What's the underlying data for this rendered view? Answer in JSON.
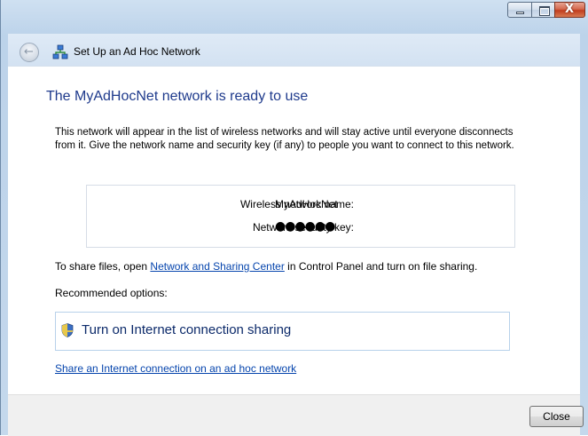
{
  "window": {
    "title": "Set Up an Ad Hoc Network",
    "caption_buttons": {
      "minimize_icon": "minimize-icon",
      "maximize_icon": "maximize-icon",
      "close_glyph": "X"
    }
  },
  "main": {
    "heading": "The MyAdHocNet network is ready to use",
    "description": "This network will appear in the list of wireless networks and will stay active until everyone disconnects from it. Give the network name and security key (if any) to people you want to connect to this network.",
    "network_info": {
      "name_label": "Wireless network name:",
      "name_value": "MyAdHocNet",
      "key_label": "Network security key:",
      "key_value": "●●●●●●"
    },
    "share_prefix": "To share files, open ",
    "share_link": "Network and Sharing Center",
    "share_suffix": " in Control Panel and turn on file sharing.",
    "recommended_label": "Recommended options:",
    "command_link": "Turn on Internet connection sharing",
    "adhoc_link": "Share an Internet connection on an ad hoc network"
  },
  "footer": {
    "close_label": "Close"
  },
  "icons": {
    "back": "back-arrow-icon",
    "network": "network-icon",
    "shield": "uac-shield-icon"
  },
  "colors": {
    "heading": "#1e3a8c",
    "link": "#0645ad",
    "close_button": "#c13d1e"
  }
}
